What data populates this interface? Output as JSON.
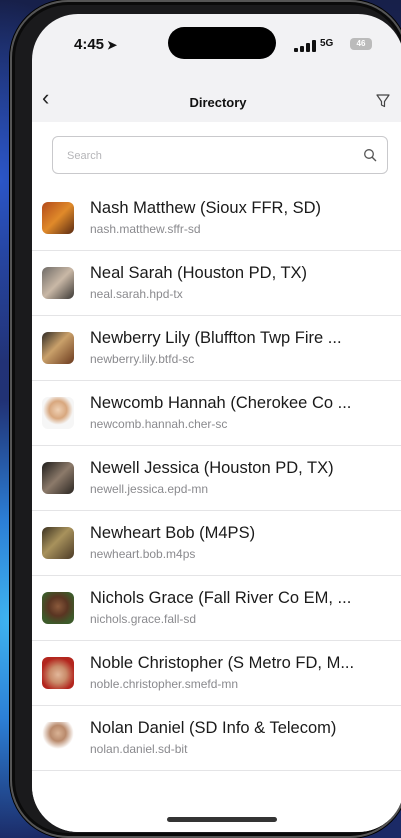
{
  "status_bar": {
    "time": "4:45",
    "network": "5G",
    "battery": "46"
  },
  "header": {
    "title": "Directory"
  },
  "search": {
    "placeholder": "Search"
  },
  "contacts": [
    {
      "name": "Nash Matthew (Sioux FFR, SD)",
      "handle": "nash.matthew.sffr-sd"
    },
    {
      "name": "Neal Sarah (Houston PD, TX)",
      "handle": "neal.sarah.hpd-tx"
    },
    {
      "name": "Newberry Lily (Bluffton Twp Fire ...",
      "handle": "newberry.lily.btfd-sc"
    },
    {
      "name": "Newcomb Hannah (Cherokee Co ...",
      "handle": "newcomb.hannah.cher-sc"
    },
    {
      "name": "Newell Jessica (Houston PD, TX)",
      "handle": "newell.jessica.epd-mn"
    },
    {
      "name": "Newheart Bob (M4PS)",
      "handle": "newheart.bob.m4ps"
    },
    {
      "name": "Nichols Grace (Fall River Co EM, ...",
      "handle": "nichols.grace.fall-sd"
    },
    {
      "name": "Noble Christopher (S Metro FD, M...",
      "handle": "noble.christopher.smefd-mn"
    },
    {
      "name": "Nolan Daniel (SD Info & Telecom)",
      "handle": "nolan.daniel.sd-bit"
    }
  ]
}
